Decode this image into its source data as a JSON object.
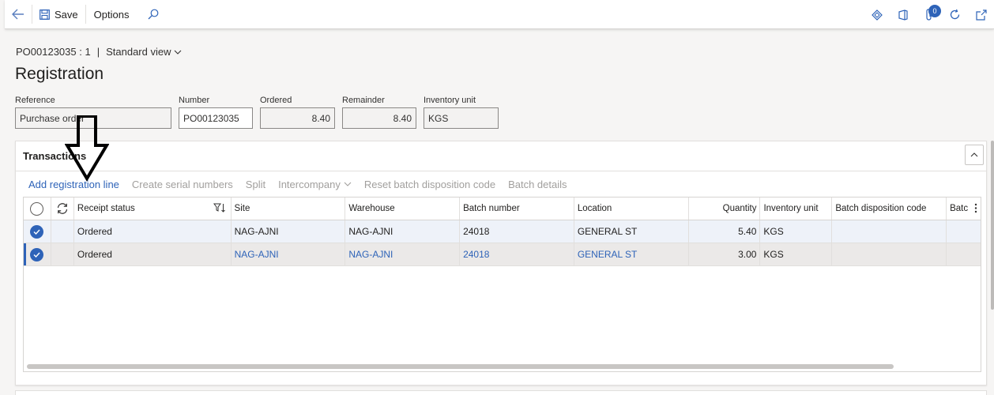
{
  "toolbar": {
    "save_label": "Save",
    "options_label": "Options",
    "notification_count": "0"
  },
  "breadcrumb": {
    "record": "PO00123035 : 1",
    "separator": "|",
    "view": "Standard view"
  },
  "page_title": "Registration",
  "fields": {
    "reference": {
      "label": "Reference",
      "value": "Purchase order"
    },
    "number": {
      "label": "Number",
      "value": "PO00123035"
    },
    "ordered": {
      "label": "Ordered",
      "value": "8.40"
    },
    "remainder": {
      "label": "Remainder",
      "value": "8.40"
    },
    "inventory_unit": {
      "label": "Inventory unit",
      "value": "KGS"
    }
  },
  "transactions": {
    "title": "Transactions",
    "actions": {
      "add_registration_line": "Add registration line",
      "create_serial_numbers": "Create serial numbers",
      "split": "Split",
      "intercompany": "Intercompany",
      "reset_batch_disposition_code": "Reset batch disposition code",
      "batch_details": "Batch details"
    },
    "columns": {
      "receipt_status": "Receipt status",
      "site": "Site",
      "warehouse": "Warehouse",
      "batch_number": "Batch number",
      "location": "Location",
      "quantity": "Quantity",
      "inventory_unit": "Inventory unit",
      "batch_disposition_code": "Batch disposition code",
      "batch_truncated": "Batc"
    },
    "rows": [
      {
        "receipt_status": "Ordered",
        "site": "NAG-AJNI",
        "warehouse": "NAG-AJNI",
        "batch_number": "24018",
        "location": "GENERAL ST",
        "quantity": "5.40",
        "inventory_unit": "KGS",
        "batch_disposition_code": ""
      },
      {
        "receipt_status": "Ordered",
        "site": "NAG-AJNI",
        "warehouse": "NAG-AJNI",
        "batch_number": "24018",
        "location": "GENERAL ST",
        "quantity": "3.00",
        "inventory_unit": "KGS",
        "batch_disposition_code": ""
      }
    ]
  },
  "colors": {
    "accent": "#2e63b8",
    "disabled_text": "#a19f9d",
    "selected_row": "#ebe9e8"
  }
}
